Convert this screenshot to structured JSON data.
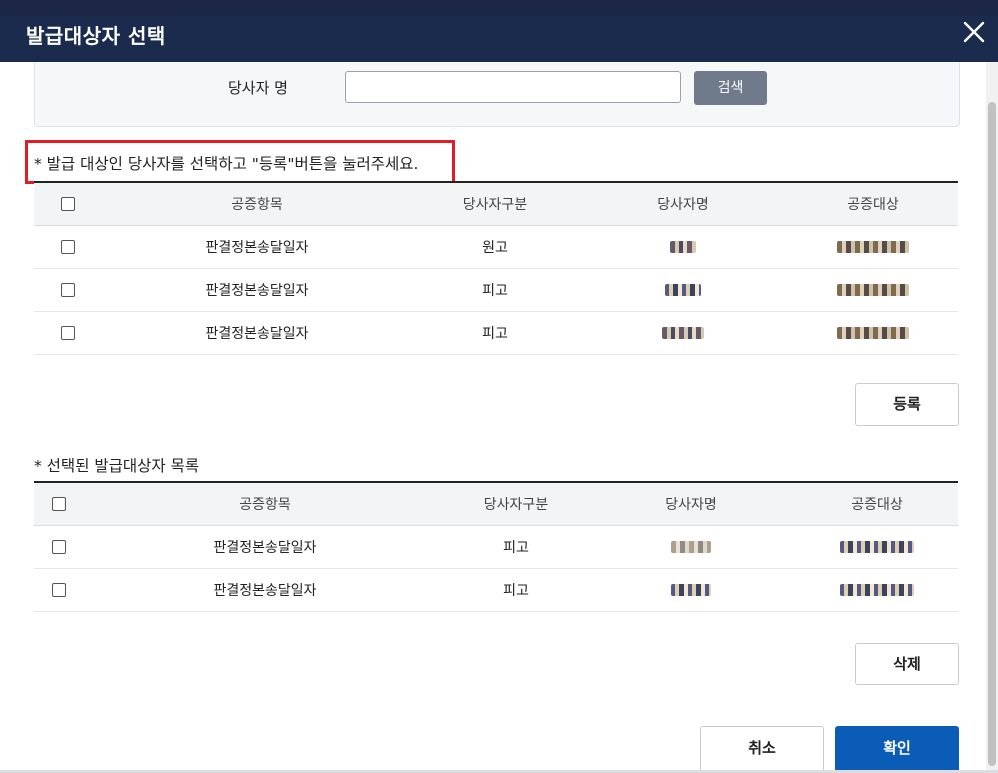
{
  "modal": {
    "title": "발급대상자 선택"
  },
  "search": {
    "label": "당사자 명",
    "value": "",
    "button": "검색"
  },
  "notice": "* 발급 대상인 당사자를 선택하고 \"등록\"버튼을 눌러주세요.",
  "table_top": {
    "columns": [
      "공증항목",
      "당사자구분",
      "당사자명",
      "공증대상"
    ],
    "rows": [
      {
        "item": "판결정본송달일자",
        "party_type": "원고"
      },
      {
        "item": "판결정본송달일자",
        "party_type": "피고"
      },
      {
        "item": "판결정본송달일자",
        "party_type": "피고"
      }
    ],
    "register_button": "등록"
  },
  "section_selected": {
    "title": "* 선택된 발급대상자 목록",
    "columns": [
      "공증항목",
      "당사자구분",
      "당사자명",
      "공증대상"
    ],
    "rows": [
      {
        "item": "판결정본송달일자",
        "party_type": "피고"
      },
      {
        "item": "판결정본송달일자",
        "party_type": "피고"
      }
    ],
    "delete_button": "삭제"
  },
  "footer": {
    "cancel_button": "취소",
    "confirm_button": "확인"
  },
  "colors": {
    "header_bg": "#1b2b4d",
    "primary": "#0b5cb7",
    "highlight_border": "#e11d25"
  }
}
